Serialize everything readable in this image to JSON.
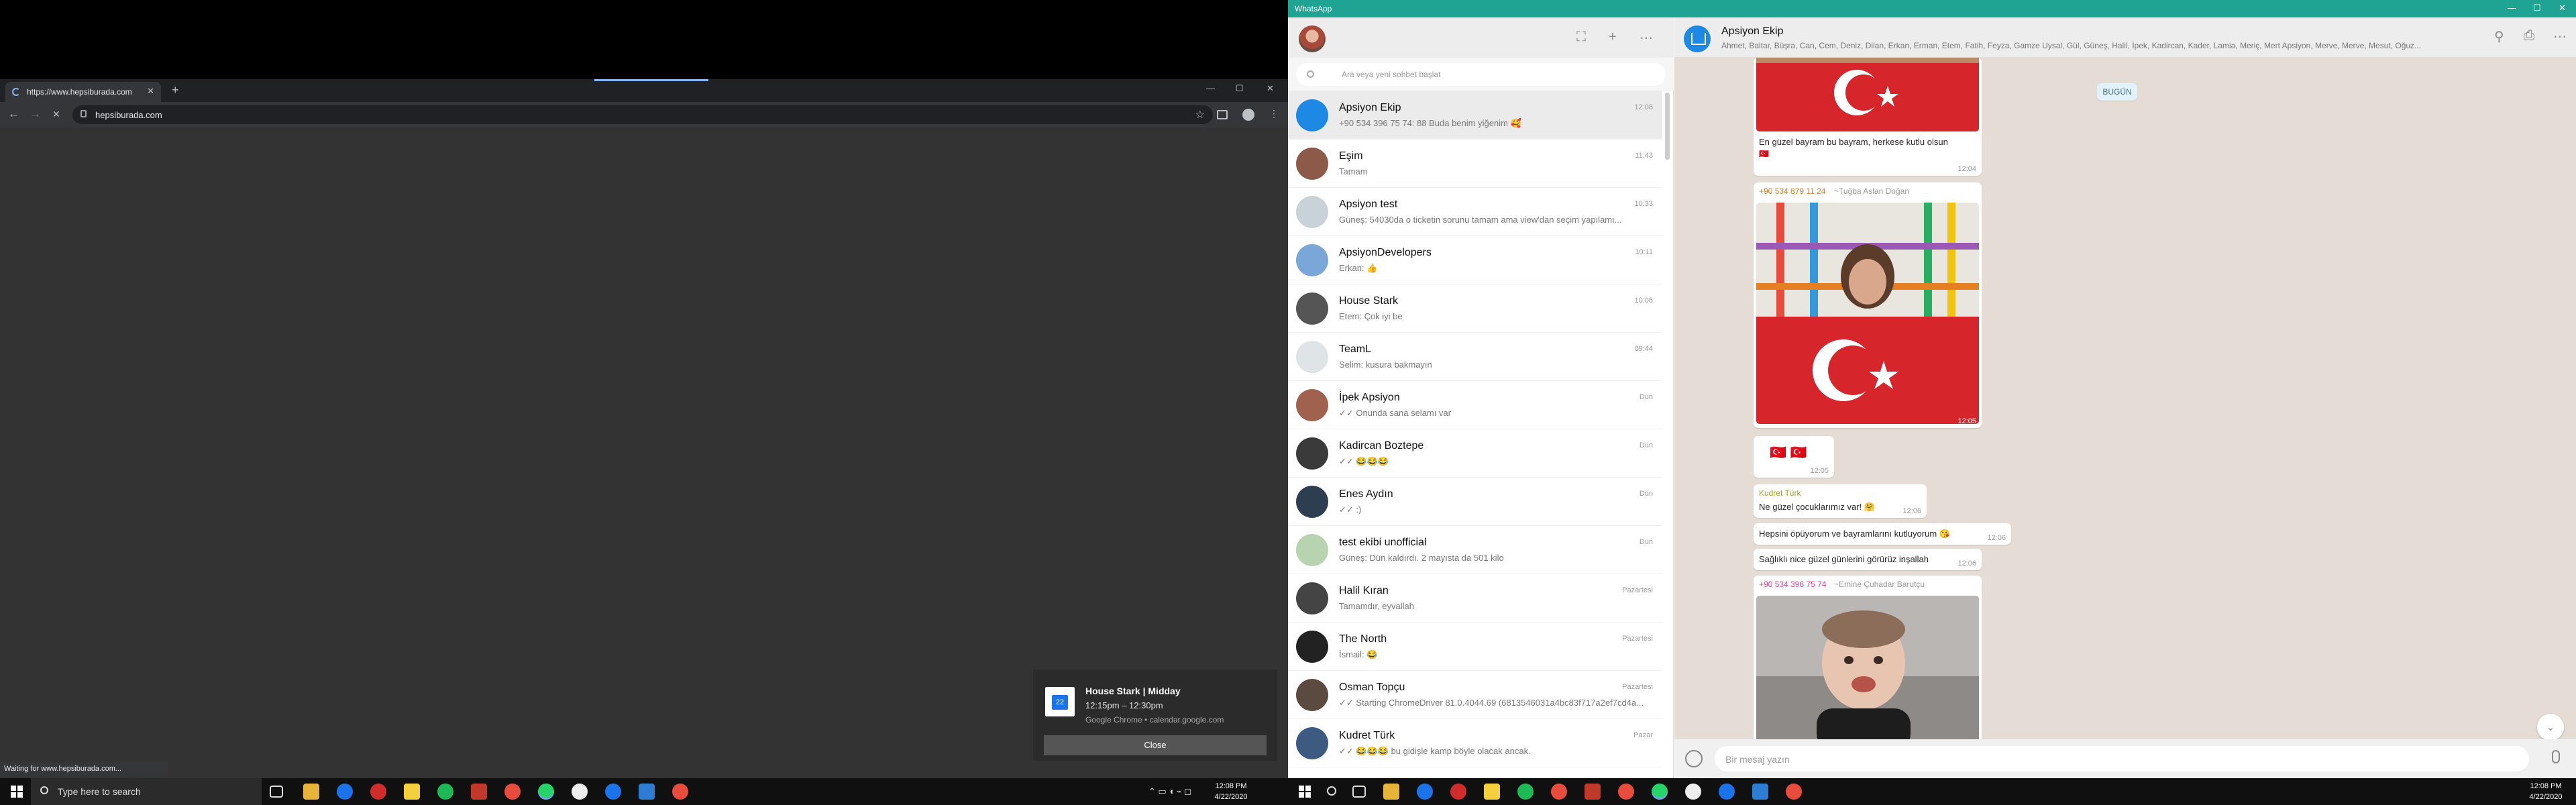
{
  "chrome": {
    "tab_title": "https://www.hepsiburada.com",
    "new_tab": "+",
    "address": "hepsiburada.com",
    "status": "Waiting for www.hepsiburada.com...",
    "tab_close": "✕",
    "back": "←",
    "forward": "→",
    "reload": "✕",
    "star": "☆",
    "menu": "⋮",
    "minimize": "—",
    "maximize": "☐",
    "close": "✕"
  },
  "toast": {
    "title": "House Stark | Midday",
    "time": "12:15pm – 12:30pm",
    "source": "Google Chrome • calendar.google.com",
    "close": "Close",
    "icon_text": "22"
  },
  "taskbar_left": {
    "search_placeholder": "Type here to search",
    "clock_time": "12:08 PM",
    "clock_date": "4/22/2020",
    "tray": "⌃ ▭ ◖ ⌁ ◻"
  },
  "taskbar_right": {
    "clock_time": "12:08 PM",
    "clock_date": "4/22/2020"
  },
  "whatsapp": {
    "window_title": "WhatsApp",
    "search_placeholder": "Ara veya yeni sohbet başlat",
    "header_icons": [
      "⛶",
      "+",
      "⋯"
    ],
    "chats": [
      {
        "name": "Apsiyon Ekip",
        "time": "12:08",
        "preview": "+90 534 396 75 74: 88 Buda benim yiğenim 🥰",
        "color": "#1e88e5"
      },
      {
        "name": "Eşim",
        "time": "11:43",
        "preview": "Tamam",
        "color": "#8d5a4a"
      },
      {
        "name": "Apsiyon test",
        "time": "10:33",
        "preview": "Güneş: 54030da o ticketin sorunu tamam ama view'dan seçim yapılamı...",
        "color": "#c9d1d9"
      },
      {
        "name": "ApsiyonDevelopers",
        "time": "10:11",
        "preview": "Erkan: 👍",
        "color": "#7aa7d8"
      },
      {
        "name": "House Stark",
        "time": "10:06",
        "preview": "Etem: Çok iyi be",
        "color": "#555"
      },
      {
        "name": "TeamL",
        "time": "09:44",
        "preview": "Selim: kusura bakmayın",
        "color": "#dfe5e7"
      },
      {
        "name": "İpek Apsiyon",
        "time": "Dün",
        "preview": "✓✓ Onunda sana selamı var",
        "color": "#a0624e"
      },
      {
        "name": "Kadircan Boztepe",
        "time": "Dün",
        "preview": "✓✓ 😂😂😂",
        "color": "#3a3a3a"
      },
      {
        "name": "Enes Aydın",
        "time": "Dün",
        "preview": "✓✓ :)",
        "color": "#2c3e50"
      },
      {
        "name": "test ekibi unofficial",
        "time": "Dün",
        "preview": "Güneş: Dün kaldırdı. 2 mayısta da 501 kilo",
        "color": "#b7d3b0"
      },
      {
        "name": "Halil Kıran",
        "time": "Pazartesi",
        "preview": "Tamamdır, eyvallah",
        "color": "#444"
      },
      {
        "name": "The North",
        "time": "Pazartesi",
        "preview": "İsmail: 😂",
        "color": "#222"
      },
      {
        "name": "Osman Topçu",
        "time": "Pazartesi",
        "preview": "✓✓ Starting ChromeDriver 81.0.4044.69 (6813546031a4bc83f717a2ef7cd4a...",
        "color": "#5b4a3f"
      },
      {
        "name": "Kudret Türk",
        "time": "Pazar",
        "preview": "✓✓ 😂😂😂 bu gidişle kamp böyle olacak ancak.",
        "color": "#3d5a80"
      }
    ],
    "group": {
      "name": "Apsiyon Ekip",
      "members": "Ahmet, Baltar, Büşra, Can, Cem, Deniz, Dilan, Erkan, Erman, Etem, Fatih, Feyza, Gamze Uysal, Gül, Güneş, Halil, İpek, Kadircan, Kader, Lamia, Meriç, Mert Apsiyon, Merve, Merve, Mesut, Oğuz..."
    },
    "today_label": "BUGÜN",
    "messages": {
      "m1_text": "En güzel bayram bu bayram, herkese kutlu olsun",
      "m1_flag": "🇹🇷",
      "m1_time": "12:04",
      "m2_sender": "+90 534 879 11 24",
      "m2_name": "~Tuğba Aslan Doğan",
      "m2_time": "12:05",
      "m3_text": "🇹🇷 🇹🇷",
      "m3_time": "12:05",
      "m4_sender": "Kudret Türk",
      "m4_text": "Ne güzel çocuklarımız var! 🤗",
      "m4_time": "12:06",
      "m5_text": "Hepsini öpüyorum ve bayramlarını kutluyorum 😘",
      "m5_time": "12:06",
      "m6_text": "Sağlıklı nice güzel günlerini görürüz inşallah",
      "m6_time": "12:06",
      "m7_sender": "+90 534 396 75 74",
      "m7_name": "~Emine Çuhadar Barutçu"
    },
    "composer_placeholder": "Bir mesaj yazın",
    "scroll_down": "⌄",
    "header_right_icons": [
      "⚲",
      "⎙",
      "⋯"
    ],
    "window_controls": [
      "—",
      "☐",
      "✕"
    ]
  },
  "colors": {
    "whatsapp_green": "#1fa393",
    "chat_bg": "#e5ddd5",
    "chrome_dark": "#202124"
  }
}
